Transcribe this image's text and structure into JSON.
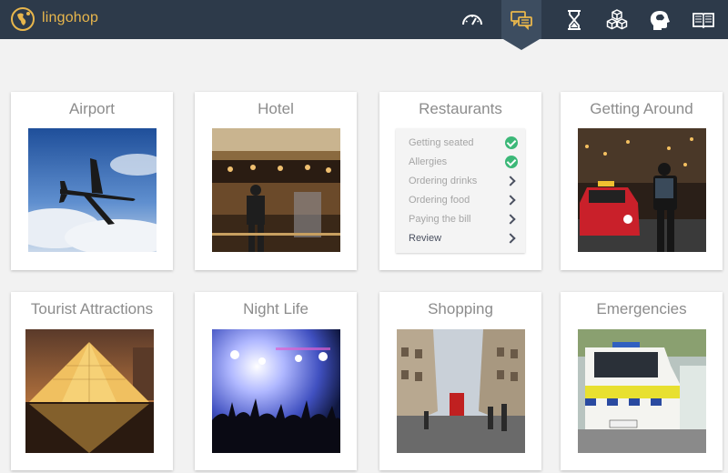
{
  "app": {
    "brand": "lingohop"
  },
  "nav": [
    {
      "name": "dashboard-icon",
      "active": false
    },
    {
      "name": "conversation-icon",
      "active": true
    },
    {
      "name": "hourglass-icon",
      "active": false
    },
    {
      "name": "cubes-icon",
      "active": false
    },
    {
      "name": "head-brain-icon",
      "active": false
    },
    {
      "name": "book-icon",
      "active": false
    }
  ],
  "cards": [
    {
      "title": "Airport",
      "image": "airplane-photo"
    },
    {
      "title": "Hotel",
      "image": "hotel-lobby-photo"
    },
    {
      "title": "Restaurants",
      "lessons": [
        {
          "label": "Getting seated",
          "status": "done"
        },
        {
          "label": "Allergies",
          "status": "done"
        },
        {
          "label": "Ordering drinks",
          "status": "open"
        },
        {
          "label": "Ordering food",
          "status": "open"
        },
        {
          "label": "Paying the bill",
          "status": "open"
        },
        {
          "label": "Review",
          "status": "current"
        }
      ]
    },
    {
      "title": "Getting Around",
      "image": "city-street-taxi-photo"
    },
    {
      "title": "Tourist Attractions",
      "image": "louvre-pyramid-photo"
    },
    {
      "title": "Night Life",
      "image": "concert-crowd-photo"
    },
    {
      "title": "Shopping",
      "image": "shopping-street-photo"
    },
    {
      "title": "Emergencies",
      "image": "ambulance-photo"
    }
  ],
  "colors": {
    "topbar": "#2d3a4a",
    "accent": "#e8b64c",
    "check": "#3cb878"
  }
}
